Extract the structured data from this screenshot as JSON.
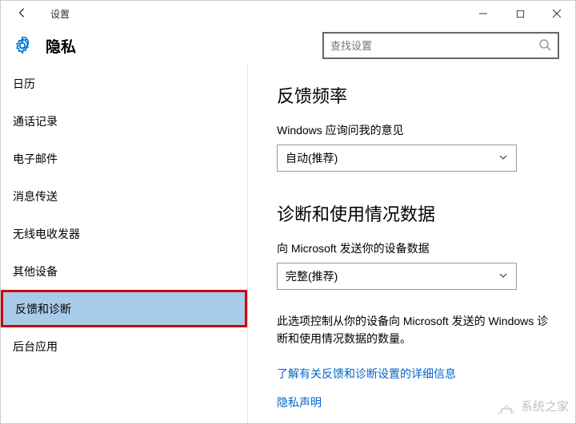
{
  "window": {
    "app_title": "设置"
  },
  "header": {
    "page_title": "隐私",
    "search_placeholder": "查找设置"
  },
  "sidebar": {
    "items": [
      {
        "label": "日历"
      },
      {
        "label": "通话记录"
      },
      {
        "label": "电子邮件"
      },
      {
        "label": "消息传送"
      },
      {
        "label": "无线电收发器"
      },
      {
        "label": "其他设备"
      },
      {
        "label": "反馈和诊断"
      },
      {
        "label": "后台应用"
      }
    ],
    "selected_index": 6
  },
  "main": {
    "section1": {
      "heading": "反馈频率",
      "label": "Windows 应询问我的意见",
      "dropdown_value": "自动(推荐)"
    },
    "section2": {
      "heading": "诊断和使用情况数据",
      "label": "向 Microsoft 发送你的设备数据",
      "dropdown_value": "完整(推荐)",
      "description": "此选项控制从你的设备向 Microsoft 发送的 Windows 诊断和使用情况数据的数量。",
      "link1": "了解有关反馈和诊断设置的详细信息",
      "link2": "隐私声明"
    }
  },
  "watermark": "系统之家"
}
